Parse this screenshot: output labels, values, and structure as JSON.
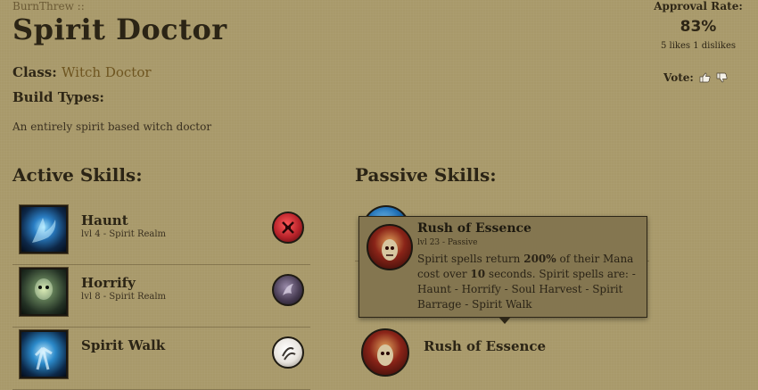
{
  "header": {
    "author": "BurnThrew ::",
    "title": "Spirit Doctor",
    "class_label": "Class:",
    "class_value": "Witch Doctor",
    "build_types_label": "Build Types:",
    "description": "An entirely spirit based witch doctor"
  },
  "rating": {
    "label": "Approval Rate:",
    "percent": "83%",
    "likes": "5 likes",
    "dislikes": "1 dislikes",
    "vote_label": "Vote:"
  },
  "active": {
    "heading": "Active Skills:",
    "skills": [
      {
        "name": "Haunt",
        "rune": "lvl 4 - Spirit Realm",
        "icon": "haunt-icon",
        "rune_color": "#b8232a"
      },
      {
        "name": "Horrify",
        "rune": "lvl 8 - Spirit Realm",
        "icon": "horrify-icon",
        "rune_color": "#4a3e55"
      },
      {
        "name": "Spirit Walk",
        "rune": "",
        "icon": "spirit-walk-icon",
        "rune_color": "#e8e4de"
      }
    ]
  },
  "passive": {
    "heading": "Passive Skills:",
    "skills": [
      {
        "name": "",
        "icon": "passive-blue-icon"
      },
      {
        "name": "Rush of Essence",
        "icon": "rush-of-essence-icon"
      }
    ]
  },
  "tooltip": {
    "name": "Rush of Essence",
    "sub": "lvl 23 - Passive",
    "body_pre": "Spirit spells return ",
    "body_bold1": "200%",
    "body_mid": " of their Mana cost over ",
    "body_bold2": "10",
    "body_post": " seconds. Spirit spells are: - Haunt - Horrify - Soul Harvest - Spirit Barrage - Spirit Walk"
  }
}
